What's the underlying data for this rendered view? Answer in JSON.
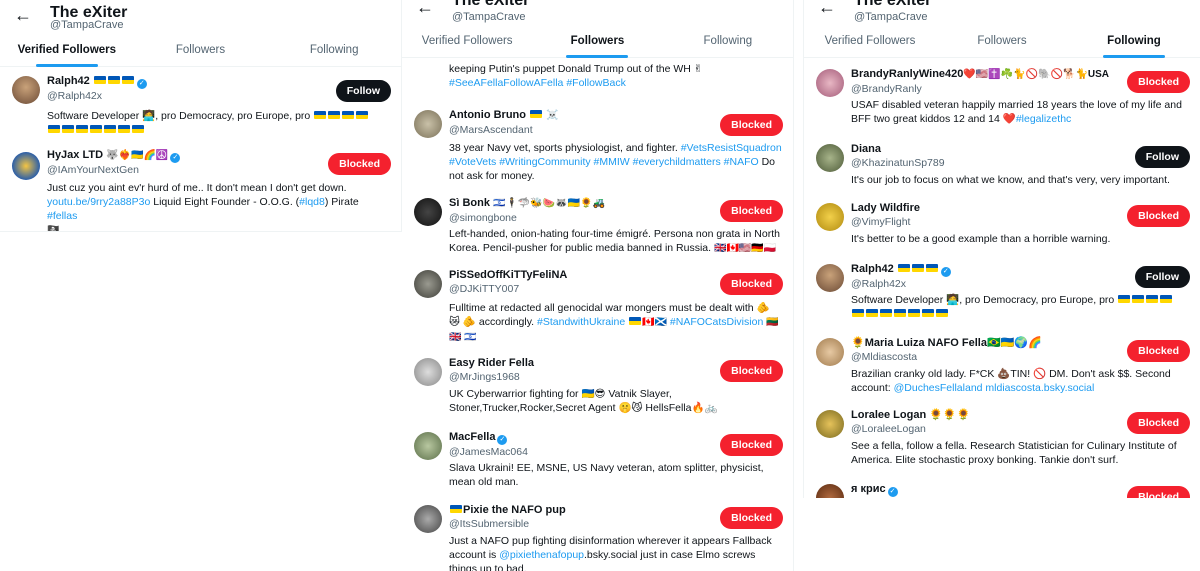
{
  "profile": {
    "name": "The eXiter",
    "handle": "@TampaCrave"
  },
  "tabs": {
    "verified": "Verified Followers",
    "followers": "Followers",
    "following": "Following"
  },
  "verified_list": [
    {
      "name": "Ralph42",
      "handle": "@Ralph42x",
      "bio": "Software Developer 🧑‍💻, pro Democracy, pro Europe, pro",
      "button": "Follow"
    },
    {
      "name": "HyJax LTD",
      "handle": "@IAmYourNextGen",
      "bio": "Just cuz you aint ev'r hurd of me.. It don't mean I don't get down.",
      "link1": "youtu.be/9rry2a88P3o",
      "bio2": "Liquid Eight Founder - O.O.G. (",
      "link2": "#lqd8",
      "bio3": ") Pirate ",
      "link3": "#fellas",
      "button": "Blocked"
    }
  ],
  "followers_list": {
    "top_text": "keeping Putin's puppet Donald Trump out of the WH ✌",
    "top_link1": "#SeeAFellaFollowAFella",
    "top_link2": "#FollowBack",
    "items": [
      {
        "name": "Antonio Bruno",
        "handle": "@MarsAscendant",
        "bio": "38 year Navy vet, sports physiologist, and fighter.",
        "tags": "#VetsResistSquadron #VoteVets #WritingCommunity #MMIW #everychildmatters #NAFO",
        "bio_end": "Do not ask for money.",
        "button": "Blocked"
      },
      {
        "name": "Sì Bonk",
        "handle": "@simongbone",
        "bio": "Left-handed, onion-hating four-time émigré. Persona non grata in North Korea. Pencil-pusher for public media banned in Russia.",
        "button": "Blocked"
      },
      {
        "name": "PiSSedOffKiTTyFeliNA",
        "handle": "@DJKiTTY007",
        "bio": "Fulltime at redacted all genocidal war mongers must be dealt with 🫵 😿 🫵 accordingly.",
        "tags": "#StandwithUkraine",
        "tags2": "#NAFOCatsDivision",
        "button": "Blocked"
      },
      {
        "name": "Easy Rider Fella",
        "handle": "@MrJings1968",
        "bio": "UK Cyberwarrior fighting for 🇺🇦😎 Vatnik Slayer, Stoner,Trucker,Rocker,Secret Agent 🤫😼 HellsFella🔥🚲",
        "button": "Blocked"
      },
      {
        "name": "MacFella",
        "handle": "@JamesMac064",
        "bio": "Slava Ukraini! EE, MSNE, US Navy veteran, atom splitter, physicist, mean old man.",
        "button": "Blocked"
      },
      {
        "name": "Pixie the NAFO pup",
        "handle": "@ItsSubmersible",
        "bio": "Just a NAFO pup fighting disinformation wherever it appears Fallback account is",
        "link": "@pixiethenafopup",
        "bio_end": ".bsky.social just in case Elmo screws things up to bad.",
        "button": "Blocked"
      }
    ]
  },
  "following_list": [
    {
      "name": "BrandyRanlyWine420",
      "name_suffix": "❤️🇺🇸✝️☘️🐈🚫🐘🚫🐕🐈USA",
      "handle": "@BrandyRanly",
      "bio": "USAF disabled veteran happily married 18 years the love of my life and BFF two great kiddos 12 and 14 ❤️",
      "link": "#legalizethc",
      "button": "Blocked"
    },
    {
      "name": "Diana",
      "handle": "@KhazinatunSp789",
      "bio": "It's our job to focus on what we know, and that's very, very important.",
      "button": "Follow"
    },
    {
      "name": "Lady Wildfire",
      "handle": "@VimyFlight",
      "bio": "It's better to be a good example than a horrible warning.",
      "button": "Blocked"
    },
    {
      "name": "Ralph42",
      "handle": "@Ralph42x",
      "bio": "Software Developer 🧑‍💻, pro Democracy, pro Europe, pro",
      "button": "Follow"
    },
    {
      "name": "🌻Maria Luiza NAFO Fella🇧🇷🇺🇦🌍🌈",
      "handle": "@Mldiascosta",
      "bio": "Brazilian cranky old lady. F*CK 💩TIN! 🚫 DM. Don't ask $$. Second account:",
      "link": "@DuchesFellaland mldiascosta.bsky.social",
      "button": "Blocked"
    },
    {
      "name": "Loralee Logan 🌻🌻🌻",
      "handle": "@LoraleeLogan",
      "bio": "See a fella, follow a fella. Research Statistician for Culinary Institute of America. Elite stochastic proxy bonking. Tankie don't surf.",
      "button": "Blocked"
    },
    {
      "name": "я крис",
      "handle": "",
      "bio": "",
      "button": "Blocked"
    }
  ],
  "colors": {
    "accent": "#1d9bf0",
    "blocked": "#f4212e",
    "follow": "#0f1419"
  }
}
